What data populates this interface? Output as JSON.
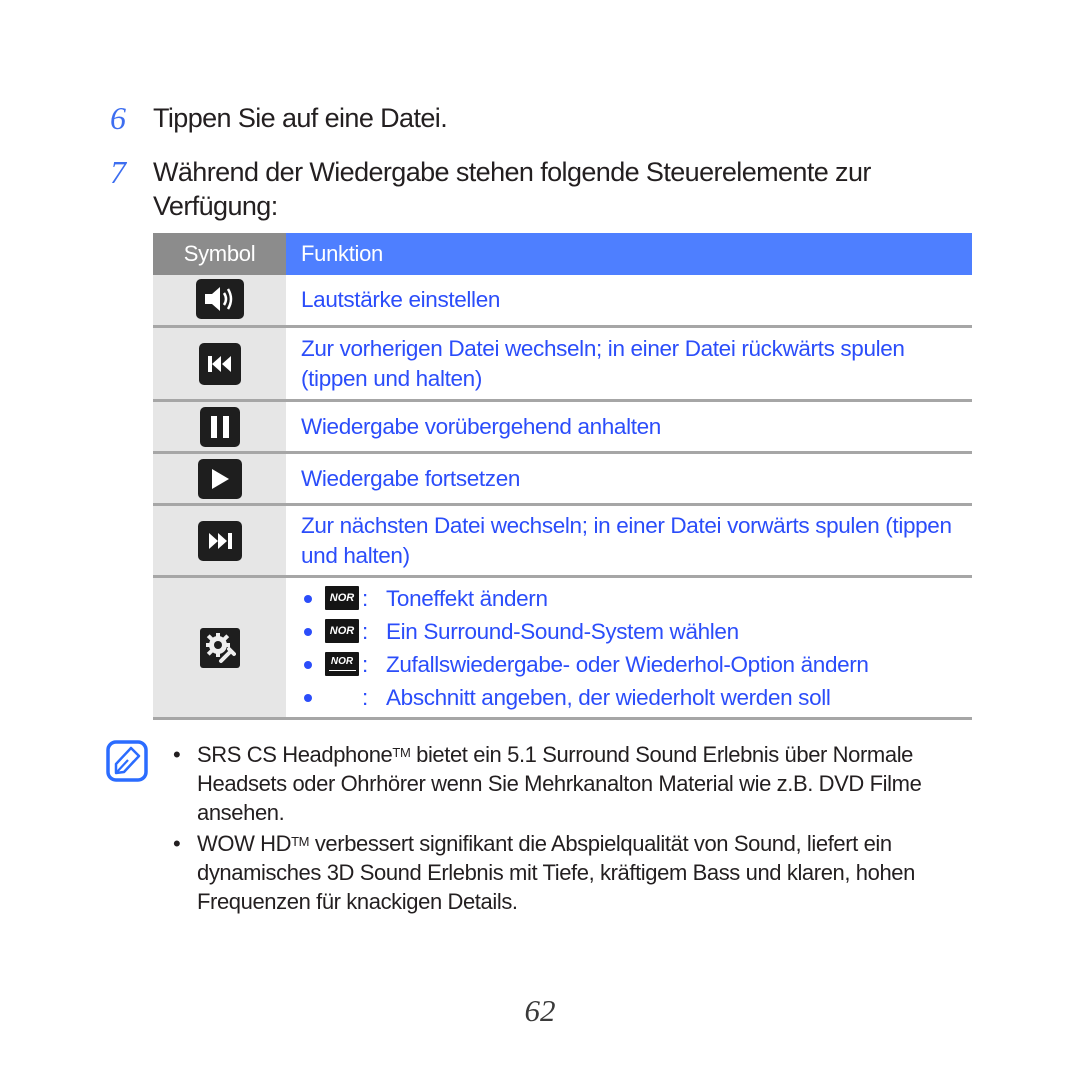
{
  "steps": [
    {
      "number": "6",
      "text": "Tippen Sie auf eine Datei."
    },
    {
      "number": "7",
      "text": "Während der Wiedergabe stehen folgende Steuerelemente zur Verfügung:"
    }
  ],
  "table": {
    "header_symbol": "Symbol",
    "header_function": "Funktion",
    "rows": [
      {
        "icon": "volume-icon",
        "function": "Lautstärke einstellen"
      },
      {
        "icon": "previous-track-icon",
        "function": "Zur vorherigen Datei wechseln; in einer Datei rückwärts spulen (tippen und halten)"
      },
      {
        "icon": "pause-icon",
        "function": "Wiedergabe vorübergehend anhalten"
      },
      {
        "icon": "play-icon",
        "function": "Wiedergabe fortsetzen"
      },
      {
        "icon": "next-track-icon",
        "function": "Zur nächsten Datei wechseln; in einer Datei vorwärts spulen (tippen und halten)"
      },
      {
        "icon": "settings-icon",
        "sub_items": [
          {
            "badge": "NOR",
            "badge_icon": "sound-effect-badge-icon",
            "label": "Toneffekt ändern"
          },
          {
            "badge": "NOR",
            "badge_icon": "surround-badge-icon",
            "label": "Ein Surround-Sound-System wählen"
          },
          {
            "badge": "NOR",
            "badge_icon": "repeat-mode-badge-icon",
            "label": "Zufallswiedergabe- oder Wiederhol-Option ändern"
          },
          {
            "badge": "",
            "badge_icon": "",
            "label": "Abschnitt angeben, der wiederholt werden soll"
          }
        ]
      }
    ]
  },
  "note": {
    "icon": "note-pencil-icon",
    "items": [
      {
        "pre": "SRS CS Headphone",
        "sup": "TM",
        "post": " bietet ein 5.1 Surround Sound Erlebnis über Normale Headsets oder Ohrhörer wenn Sie Mehrkanalton Material wie z.B. DVD Filme ansehen."
      },
      {
        "pre": "WOW HD",
        "sup": "TM",
        "post": " verbessert signifikant die Abspielqualität von Sound, liefert ein dynamisches 3D Sound Erlebnis mit Tiefe, kräftigem Bass und klaren, hohen Frequenzen für knackigen Details."
      }
    ]
  },
  "page_number": "62",
  "colors": {
    "accent": "#4e7fff",
    "link_text": "#2b4dfa",
    "header_gray": "#8c8c8c",
    "symbol_cell": "#e6e6e6"
  }
}
